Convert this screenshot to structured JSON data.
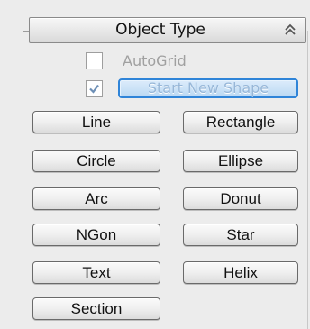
{
  "rollout": {
    "title": "Object Type",
    "collapse_icon": "double-chevron-up-icon",
    "autogrid": {
      "label": "AutoGrid",
      "checked": false,
      "enabled": false
    },
    "start_new_shape": {
      "label": "Start New Shape",
      "checked": true,
      "enabled": false
    },
    "buttons": [
      "Line",
      "Rectangle",
      "Circle",
      "Ellipse",
      "Arc",
      "Donut",
      "NGon",
      "Star",
      "Text",
      "Helix",
      "Section"
    ]
  },
  "colors": {
    "panel_bg": "#ececec",
    "highlight_border": "#2f84d8",
    "disabled_text": "#a0a0a0"
  }
}
